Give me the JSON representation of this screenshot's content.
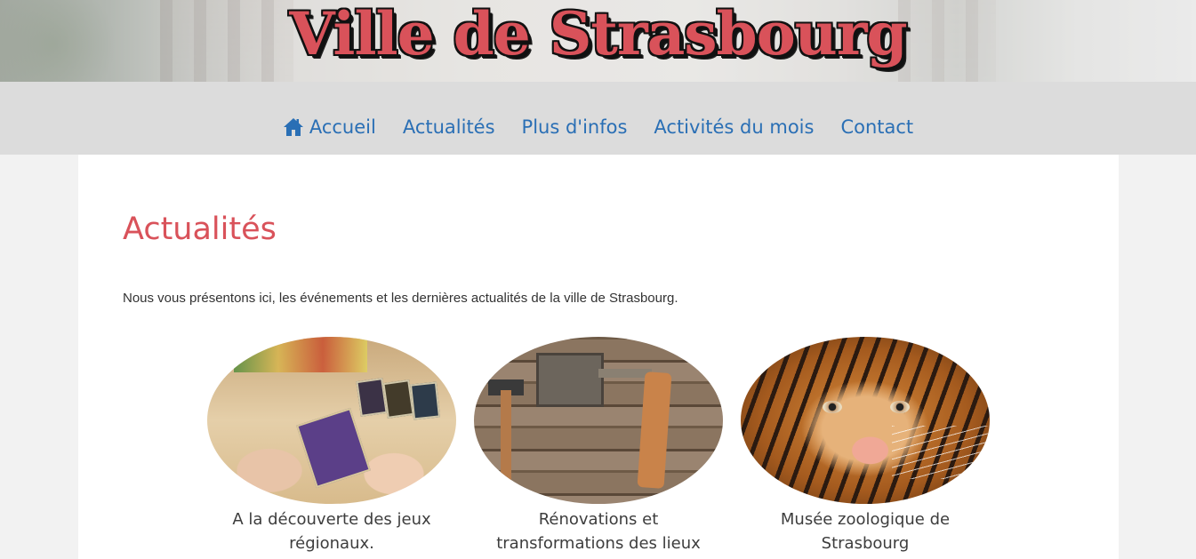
{
  "site": {
    "title": "Ville de Strasbourg"
  },
  "nav": {
    "items": [
      {
        "label": "Accueil",
        "icon": "home-icon"
      },
      {
        "label": "Actualités"
      },
      {
        "label": "Plus d'infos"
      },
      {
        "label": "Activités du mois"
      },
      {
        "label": "Contact"
      }
    ]
  },
  "main": {
    "title": "Actualités",
    "intro": "Nous vous présentons ici, les événements et les dernières actualités de la ville de Strasbourg.",
    "cards": [
      {
        "caption": "A la découverte des jeux régionaux.",
        "image": "board-game-photo"
      },
      {
        "caption": "Rénovations et transformations des lieux",
        "image": "tools-on-wood-photo"
      },
      {
        "caption": "Musée zoologique de Strasbourg",
        "image": "tiger-photo"
      }
    ]
  },
  "colors": {
    "accent": "#d9525a",
    "link": "#2a6fb5",
    "nav_bg": "#dcdcdc",
    "page_bg": "#f2f2f2"
  }
}
